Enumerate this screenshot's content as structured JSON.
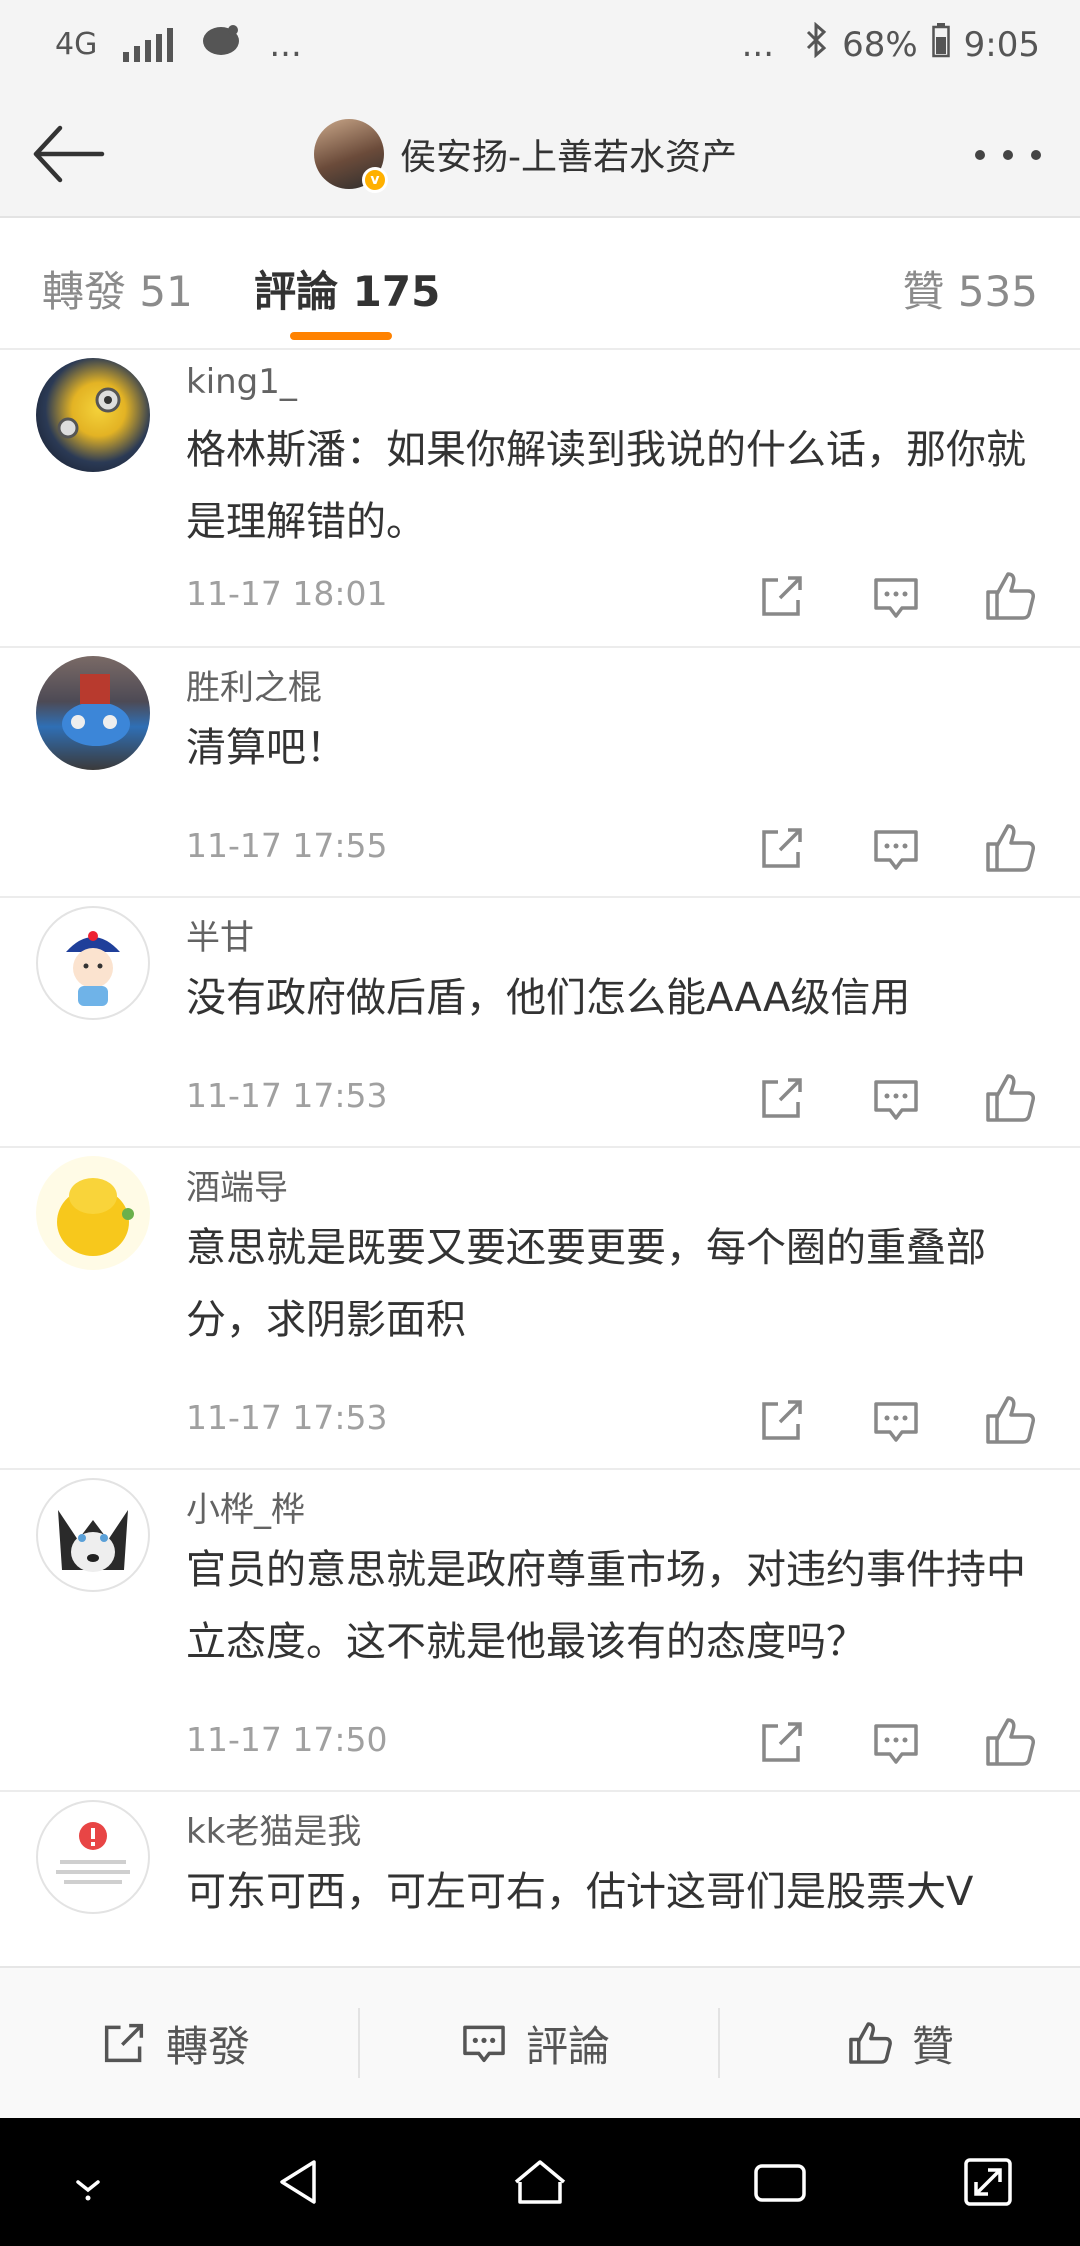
{
  "status_bar": {
    "network": "4G",
    "signal_icon": "signal-icon",
    "app_icon": "weibo-icon",
    "left_ellipsis": "...",
    "right_ellipsis": "...",
    "bluetooth_icon": "bluetooth-icon",
    "battery": "68%",
    "time": "9:05"
  },
  "header": {
    "title": "侯安扬-上善若水资产",
    "verified_mark": "v"
  },
  "tabs": {
    "reposts": "轉發 51",
    "comments": "評論 175",
    "likes": "贊 535"
  },
  "comments": [
    {
      "user": "king1_",
      "text": "格林斯潘：如果你解读到我说的什么话，那你就是理解错的。",
      "time": "11-17 18:01"
    },
    {
      "user": "胜利之棍",
      "text": "清算吧！",
      "time": "11-17 17:55"
    },
    {
      "user": "半甘",
      "text": "没有政府做后盾，他们怎么能AAA级信用",
      "time": "11-17 17:53"
    },
    {
      "user": "酒端导",
      "text": "意思就是既要又要还要更要，每个圈的重叠部分，求阴影面积",
      "time": "11-17 17:53"
    },
    {
      "user": "小桦_桦",
      "text": "官员的意思就是政府尊重市场，对违约事件持中立态度。这不就是他最该有的态度吗？",
      "time": "11-17 17:50"
    },
    {
      "user": "kk老猫是我",
      "text": "可东可西，可左可右，估计这哥们是股票大V",
      "time": ""
    }
  ],
  "bottom_bar": {
    "repost": "轉發",
    "comment": "評論",
    "like": "贊"
  },
  "colors": {
    "accent": "#ff8200",
    "text_primary": "#333333",
    "text_secondary": "#a0a0a0",
    "background": "#f4f4f4"
  }
}
